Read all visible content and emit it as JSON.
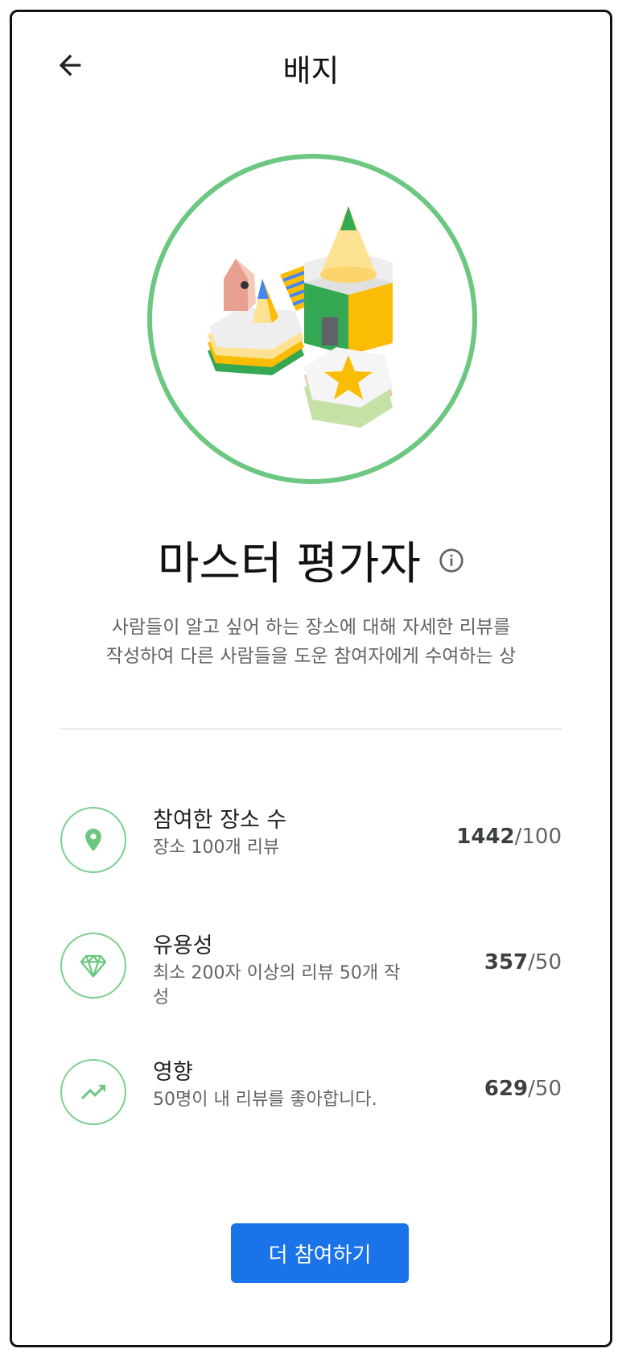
{
  "header": {
    "title": "배지",
    "back_icon": "arrow-left-icon"
  },
  "badge": {
    "image": "master-reviewer-badge-illustration",
    "title": "마스터 평가자",
    "info_icon": "info-icon",
    "description_line1": "사람들이 알고 싶어 하는 장소에 대해 자세한 리뷰를",
    "description_line2": "작성하여 다른 사람들을 도운 참여자에게 수여하는 상"
  },
  "stats": [
    {
      "icon": "location-pin-icon",
      "title": "참여한 장소 수",
      "subtitle": "장소 100개 리뷰",
      "current": "1442",
      "target": "/100"
    },
    {
      "icon": "diamond-icon",
      "title": "유용성",
      "subtitle": "최소 200자 이상의 리뷰 50개 작성",
      "current": "357",
      "target": "/50"
    },
    {
      "icon": "trending-up-icon",
      "title": "영향",
      "subtitle": "50명이 내 리뷰를 좋아합니다.",
      "current": "629",
      "target": "/50"
    }
  ],
  "cta": {
    "label": "더 참여하기"
  },
  "colors": {
    "accent_green": "#6cc780",
    "button_blue": "#1a73e8"
  }
}
